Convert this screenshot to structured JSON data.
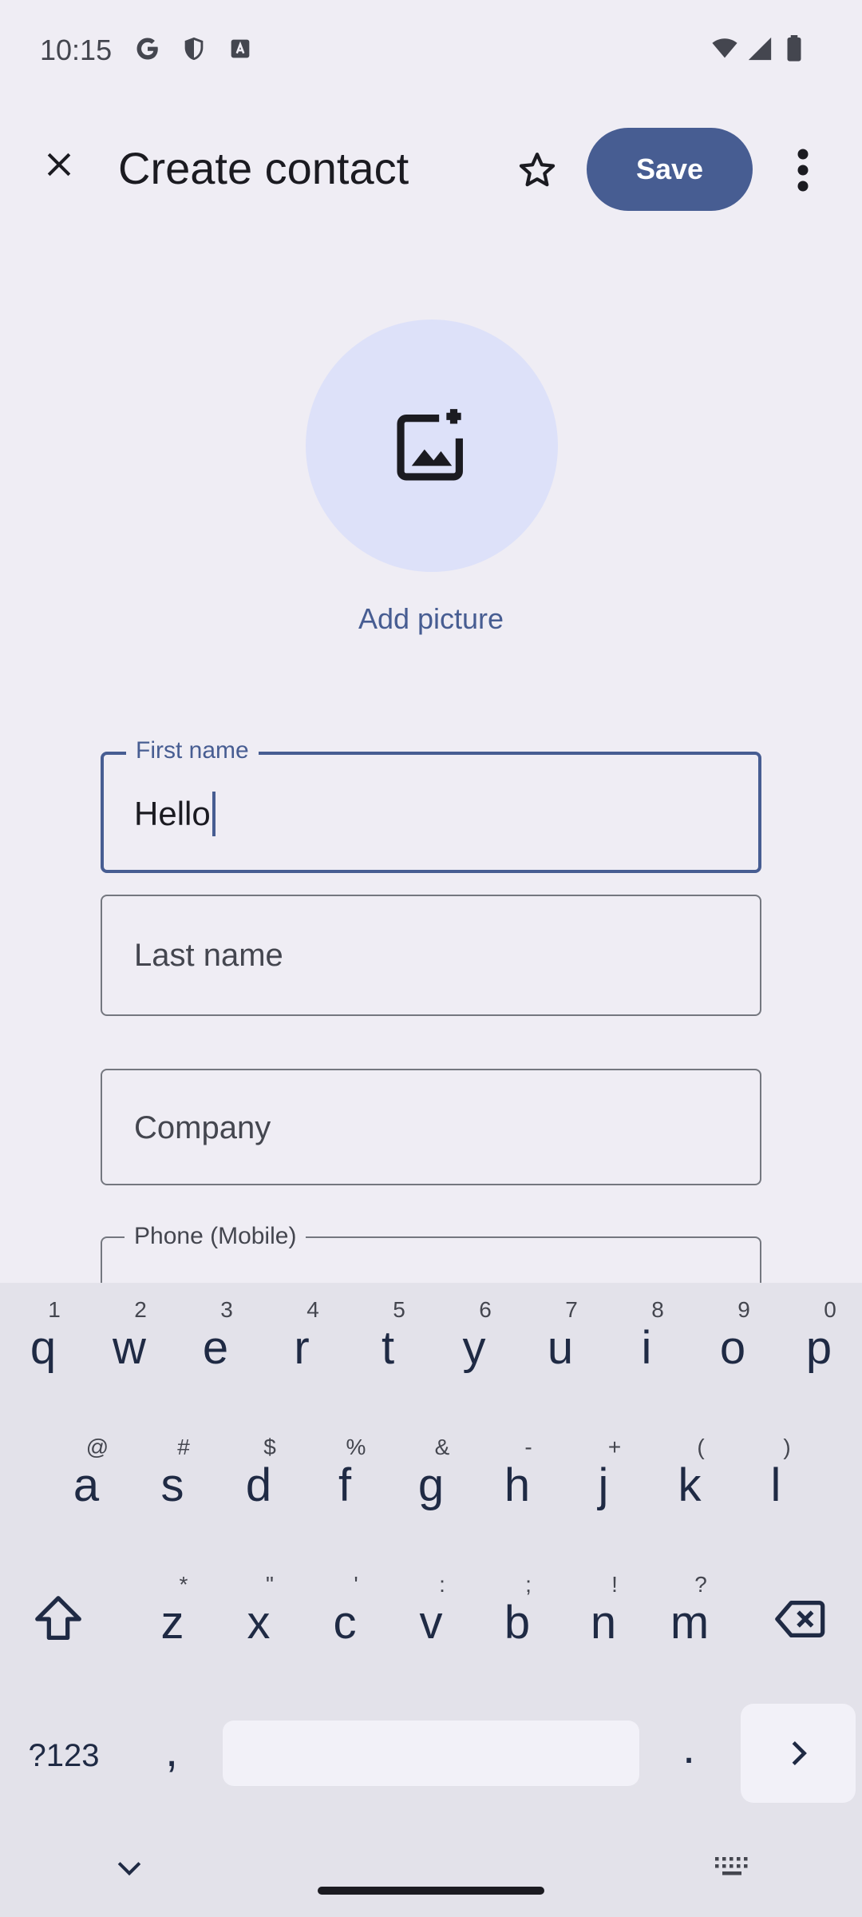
{
  "status_bar": {
    "time": "10:15"
  },
  "app_bar": {
    "title": "Create contact",
    "save_label": "Save"
  },
  "avatar": {
    "add_picture_label": "Add picture"
  },
  "form": {
    "first_name": {
      "label": "First name",
      "value": "Hello"
    },
    "last_name": {
      "placeholder": "Last name"
    },
    "company": {
      "placeholder": "Company"
    },
    "phone": {
      "label": "Phone (Mobile)"
    }
  },
  "keyboard": {
    "row1": [
      {
        "key": "q",
        "sup": "1"
      },
      {
        "key": "w",
        "sup": "2"
      },
      {
        "key": "e",
        "sup": "3"
      },
      {
        "key": "r",
        "sup": "4"
      },
      {
        "key": "t",
        "sup": "5"
      },
      {
        "key": "y",
        "sup": "6"
      },
      {
        "key": "u",
        "sup": "7"
      },
      {
        "key": "i",
        "sup": "8"
      },
      {
        "key": "o",
        "sup": "9"
      },
      {
        "key": "p",
        "sup": "0"
      }
    ],
    "row2": [
      {
        "key": "a",
        "sup": "@"
      },
      {
        "key": "s",
        "sup": "#"
      },
      {
        "key": "d",
        "sup": "$"
      },
      {
        "key": "f",
        "sup": "%"
      },
      {
        "key": "g",
        "sup": "&"
      },
      {
        "key": "h",
        "sup": "-"
      },
      {
        "key": "j",
        "sup": "+"
      },
      {
        "key": "k",
        "sup": "("
      },
      {
        "key": "l",
        "sup": ")"
      }
    ],
    "row3": [
      {
        "key": "z",
        "sup": "*"
      },
      {
        "key": "x",
        "sup": "\""
      },
      {
        "key": "c",
        "sup": "'"
      },
      {
        "key": "v",
        "sup": ":"
      },
      {
        "key": "b",
        "sup": ";"
      },
      {
        "key": "n",
        "sup": "!"
      },
      {
        "key": "m",
        "sup": "?"
      }
    ],
    "symbols_label": "?123",
    "comma": ",",
    "period": "."
  },
  "colors": {
    "accent": "#475d92",
    "background": "#efedf4",
    "avatar_bg": "#dde1f9"
  }
}
